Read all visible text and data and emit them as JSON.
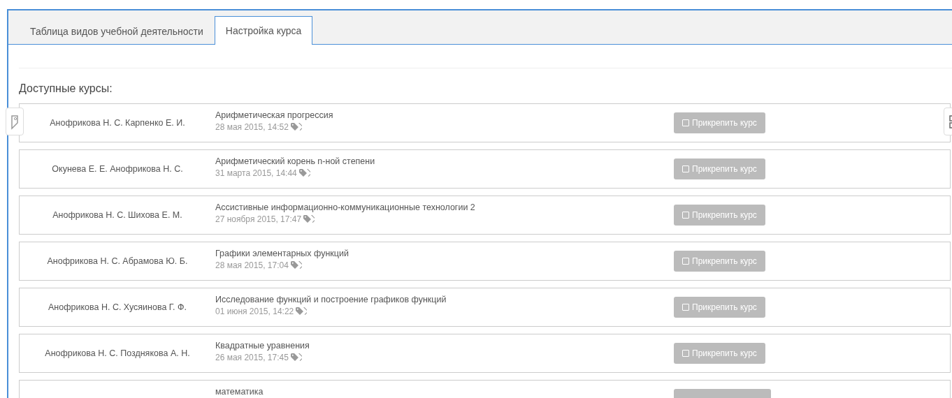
{
  "tabs": [
    {
      "label": "Таблица видов учебной деятельности",
      "selected": false
    },
    {
      "label": "Настройка курса",
      "selected": true
    }
  ],
  "heading": "Доступные курсы:",
  "courses": [
    {
      "authors": "Анофрикова Н. С. Карпенко Е. И.",
      "title": "Арифметическая прогрессия",
      "date": "28 мая 2015, 14:52",
      "button": {
        "label": "Прикрепить курс",
        "disabled": true
      }
    },
    {
      "authors": "Окунева Е. Е. Анофрикова Н. С.",
      "title": "Арифметический корень n-ной степени",
      "date": "31 марта 2015, 14:44",
      "button": {
        "label": "Прикрепить курс",
        "disabled": true
      }
    },
    {
      "authors": "Анофрикова Н. С. Шихова Е. М.",
      "title": "Ассистивные информационно-коммуникационные технологии 2",
      "date": "27 ноября 2015, 17:47",
      "button": {
        "label": "Прикрепить курс",
        "disabled": true
      }
    },
    {
      "authors": "Анофрикова Н. С. Абрамова Ю. Б.",
      "title": "Графики элементарных функций",
      "date": "28 мая 2015, 17:04",
      "button": {
        "label": "Прикрепить курс",
        "disabled": true
      }
    },
    {
      "authors": "Анофрикова Н. С. Хусяинова Г. Ф.",
      "title": "Исследование функций и построение графиков функций",
      "date": "01 июня 2015, 14:22",
      "button": {
        "label": "Прикрепить курс",
        "disabled": true
      }
    },
    {
      "authors": "Анофрикова Н. С. Позднякова А. Н.",
      "title": "Квадратные уравнения",
      "date": "26 мая 2015, 17:45",
      "button": {
        "label": "Прикрепить курс",
        "disabled": true
      }
    },
    {
      "title": "математика",
      "button": {
        "disabled": true
      }
    }
  ]
}
